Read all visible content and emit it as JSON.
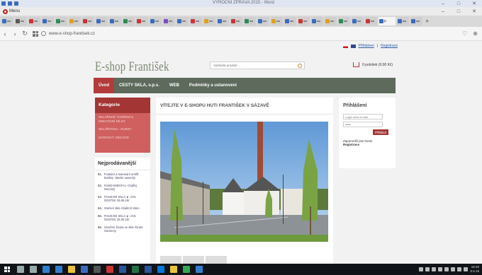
{
  "word": {
    "title": "VÝROČNÍ ZPRÁVA 2015 - Word"
  },
  "browser": {
    "menu_label": "Menu",
    "active_tab_label": "p",
    "url": "www.e-shop-frantisek.cz"
  },
  "top": {
    "login_link": "Přihlášení",
    "separator": "|",
    "register_link": "Registrace"
  },
  "header": {
    "logo": "E-shop František",
    "search_placeholder": "Vyhledat produkt ...",
    "cart": "0 položek (0.00 Kč)"
  },
  "nav": [
    {
      "label": "Úvod"
    },
    {
      "label": "CESTY SKLA, o.p.s."
    },
    {
      "label": "WEB"
    },
    {
      "label": "Podmínky a ustanovení"
    }
  ],
  "categories": {
    "title": "Kategorie",
    "items": [
      "SKLÁŘSKÉ TVOŘENÍ S KREATIVNÍ DÍLNY",
      "SKLÁŘOVNA - KURZY",
      "DÁRKOVÝ OBCHOD"
    ]
  },
  "bestsellers": {
    "title": "Nejprodávanější",
    "items": [
      {
        "num": "01.",
        "text": "Foukání a tvarování umělf bubliny -Martin Janecký"
      },
      {
        "num": "02.",
        "text": "FUNDAMENTAL -Ondřej Novotný"
      },
      {
        "num": "03.",
        "text": "FOUKÁNÍ SKLA ► JAN ŠOSTEK 25.06.16/"
      },
      {
        "num": "04.",
        "text": "Stočení skla Vladimír Klein"
      },
      {
        "num": "05.",
        "text": "FOUKÁNÍ SKLA ► JAN ŠOSTEK 26.06.16/"
      },
      {
        "num": "06.",
        "text": "Stvoření života ve skle /Grant Garmezy"
      }
    ]
  },
  "main": {
    "heading": "VÍTEJTE V E-SHOPU HUTI FRANTIŠEK V SÁZAVĚ"
  },
  "login": {
    "title": "Přihlášení",
    "email_placeholder": "Login nebo e-mail",
    "password_value": "*****",
    "submit": "Přihlásit",
    "forgot": "Zapomněli jste heslo",
    "register": "Registrace"
  },
  "taskbar": {
    "time": "16:20",
    "date": "5.6.16"
  }
}
